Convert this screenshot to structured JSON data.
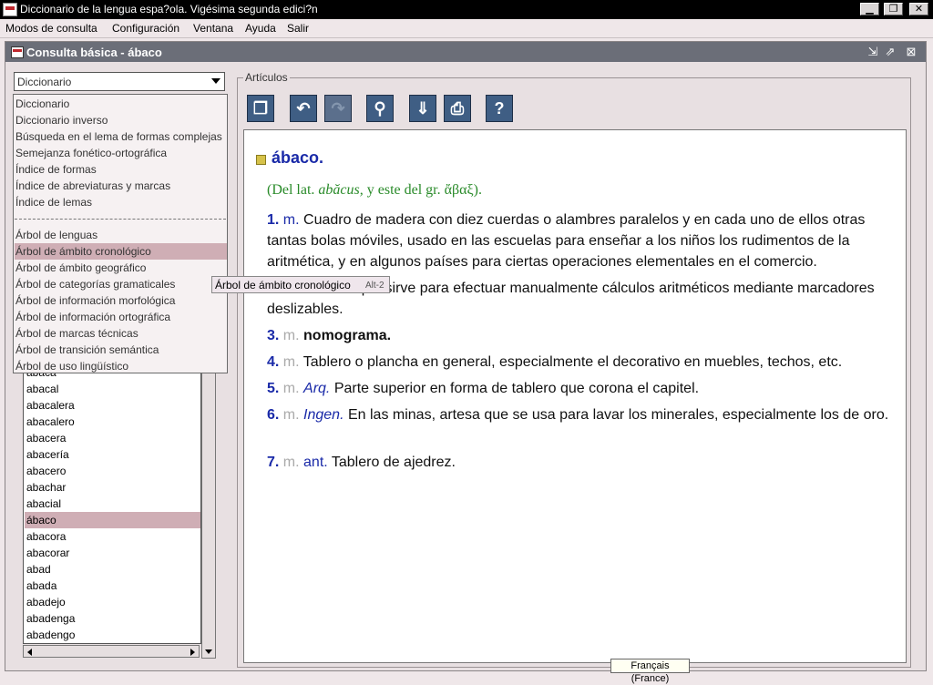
{
  "window": {
    "title": "Diccionario de la lengua espa?ola. Vigésima segunda edici?n",
    "buttons": {
      "minimize": "▁",
      "maximize": "❐",
      "close": "✕"
    }
  },
  "menubar": {
    "items": [
      "Modos de consulta",
      "Configuración",
      "Ventana",
      "Ayuda",
      "Salir"
    ]
  },
  "frame": {
    "title": "Consulta básica - ábaco"
  },
  "combo": {
    "selected": "Diccionario"
  },
  "dropdown": {
    "options_group1": [
      "Diccionario",
      "Diccionario inverso",
      "Búsqueda en el lema de formas complejas",
      "Semejanza fonético-ortográfica",
      "Índice de formas",
      "Índice de abreviaturas y marcas",
      "Índice de lemas"
    ],
    "options_group2": [
      "Árbol de lenguas",
      "Árbol de ámbito cronológico",
      "Árbol de ámbito geográfico",
      "Árbol de categorías gramaticales",
      "Árbol de información morfológica",
      "Árbol de información ortográfica",
      "Árbol de marcas técnicas",
      "Árbol de transición semántica",
      "Árbol de uso lingüístico"
    ],
    "highlighted": "Árbol de ámbito cronológico"
  },
  "tooltip": {
    "text": "Árbol de ámbito cronológico",
    "accelerator": "Alt-2"
  },
  "wordlist": {
    "items": [
      "abaca",
      "abacal",
      "abacalera",
      "abacalero",
      "abacera",
      "abacería",
      "abacero",
      "abachar",
      "abacial",
      "ábaco",
      "abacora",
      "abacorar",
      "abad",
      "abada",
      "abadejo",
      "abadenga",
      "abadengo"
    ],
    "selected": "ábaco"
  },
  "articles": {
    "group_label": "Artículos",
    "tools": [
      "copy-icon",
      "undo-icon",
      "redo-icon",
      "search-icon",
      "export-icon",
      "print-icon",
      "help-icon"
    ],
    "headword": "ábaco",
    "etymology": {
      "prefix": "(Del lat.",
      "latin": "abăcus,",
      "middle": "y este del gr.",
      "greek": "ἄβαξ",
      "suffix": ")."
    },
    "senses": [
      {
        "num": "1.",
        "gram": "m.",
        "field": "",
        "text": "Cuadro de madera con diez cuerdas o alambres paralelos y en cada uno de ellos otras tantas bolas móviles, usado en las escuelas para enseñar a los niños los rudimentos de la aritmética, y en algunos países para ciertas operaciones elementales en el comercio."
      },
      {
        "num": "",
        "gram": "",
        "field": "",
        "text": "mento que sirve para efectuar manualmente cálculos aritméticos mediante marcadores deslizables."
      },
      {
        "num": "3.",
        "gram": "m.",
        "field": "",
        "text": "nomograma."
      },
      {
        "num": "4.",
        "gram": "m.",
        "field": "",
        "text": "Tablero o plancha en general, especialmente el decorativo en muebles, techos, etc."
      },
      {
        "num": "5.",
        "gram": "m.",
        "field": "Arq.",
        "text": "Parte superior en forma de tablero que corona el capitel."
      },
      {
        "num": "6.",
        "gram": "m.",
        "field": "Ingen.",
        "text": "En las minas, artesa que se usa para lavar los minerales, especialmente los de oro."
      },
      {
        "num": "7.",
        "gram": "m.",
        "field": "ant.",
        "text": "Tablero de ajedrez."
      }
    ]
  },
  "locale_tip": "Français (France)",
  "colors": {
    "selection": "#cfaeb5",
    "headword": "#1a2aa8",
    "etymology": "#2a8b2a",
    "toolbar_button": "#3f5e84"
  }
}
